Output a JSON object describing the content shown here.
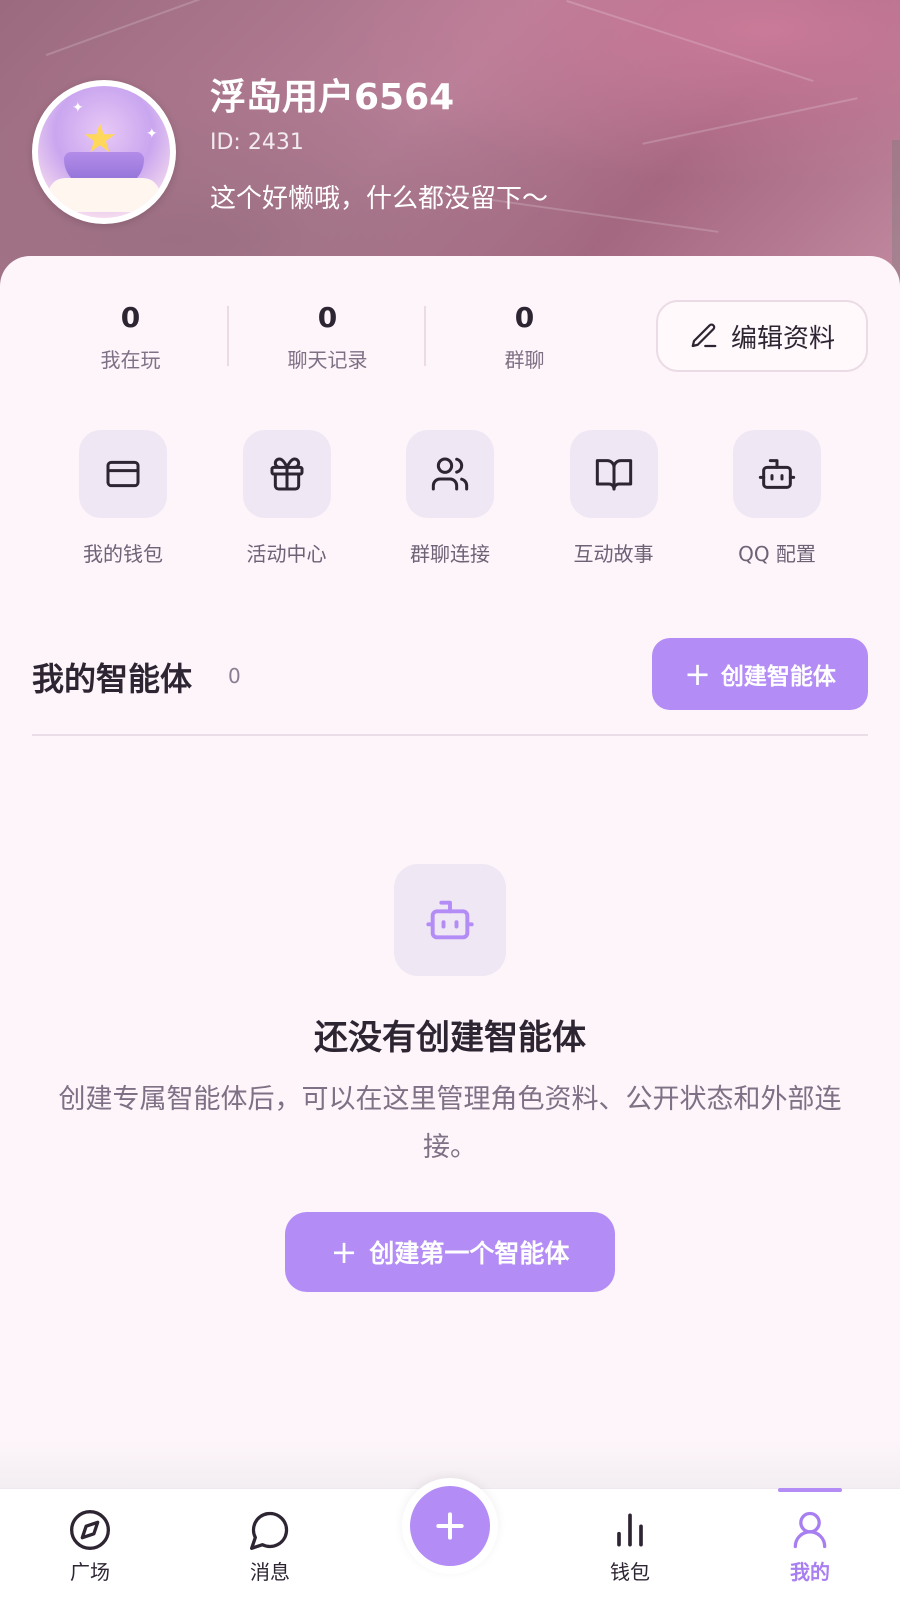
{
  "profile": {
    "username": "浮岛用户6564",
    "id_text": "ID: 2431",
    "bio": "这个好懒哦，什么都没留下～"
  },
  "stats": [
    {
      "value": "0",
      "label": "我在玩"
    },
    {
      "value": "0",
      "label": "聊天记录"
    },
    {
      "value": "0",
      "label": "群聊"
    }
  ],
  "edit_button": {
    "label": "编辑资料",
    "icon": "pencil-icon"
  },
  "quick_actions": [
    {
      "label": "我的钱包",
      "icon": "credit-card-icon"
    },
    {
      "label": "活动中心",
      "icon": "gift-icon"
    },
    {
      "label": "群聊连接",
      "icon": "users-icon"
    },
    {
      "label": "互动故事",
      "icon": "book-open-icon"
    },
    {
      "label": "QQ 配置",
      "icon": "bot-icon"
    }
  ],
  "agents_section": {
    "title": "我的智能体",
    "count": "0",
    "create_label": "创建智能体"
  },
  "empty_state": {
    "icon": "bot-icon",
    "title": "还没有创建智能体",
    "description": "创建专属智能体后，可以在这里管理角色资料、公开状态和外部连接。",
    "button_label": "创建第一个智能体"
  },
  "tabbar": {
    "active": "我的",
    "tabs": [
      {
        "label": "广场",
        "icon": "compass-icon"
      },
      {
        "label": "消息",
        "icon": "message-circle-icon"
      },
      {
        "label": "",
        "icon": "plus-icon"
      },
      {
        "label": "钱包",
        "icon": "bar-chart-icon"
      },
      {
        "label": "我的",
        "icon": "user-icon"
      }
    ]
  },
  "colors": {
    "accent": "#b38cf6",
    "text": "#2e2533",
    "muted": "#7e7085",
    "icon_tile": "#efe7f4",
    "page_bg": "#fdf5fa"
  }
}
